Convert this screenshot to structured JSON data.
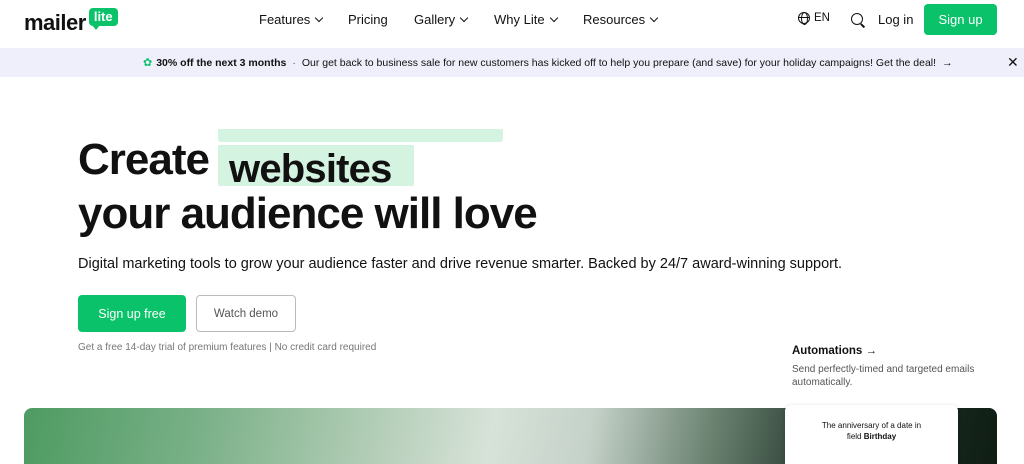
{
  "header": {
    "logo_text": "mailer",
    "logo_badge": "lite",
    "nav": [
      {
        "label": "Features",
        "has_dropdown": true
      },
      {
        "label": "Pricing",
        "has_dropdown": false
      },
      {
        "label": "Gallery",
        "has_dropdown": true
      },
      {
        "label": "Why Lite",
        "has_dropdown": true
      },
      {
        "label": "Resources",
        "has_dropdown": true
      }
    ],
    "language": "EN",
    "login_label": "Log in",
    "signup_label": "Sign up"
  },
  "promo": {
    "icon": "clover-icon",
    "highlight": "30% off the next 3 months",
    "separator": "·",
    "message": "Our get back to business sale for new customers has kicked off to help you prepare (and save) for your holiday campaigns! Get the deal!",
    "arrow": "→",
    "close": "✕"
  },
  "hero": {
    "headline_start": "Create",
    "headline_rotating_word": "websites",
    "headline_end": "your audience will love",
    "subheadline": "Digital marketing tools to grow your audience faster and drive revenue smarter. Backed by 24/7 award-winning support.",
    "primary_cta": "Sign up free",
    "secondary_cta": "Watch demo",
    "trial_note": "Get a free 14-day trial of premium features | No credit card required"
  },
  "feature_callout": {
    "title": "Automations",
    "arrow": "→",
    "description": "Send perfectly-timed and targeted emails automatically."
  },
  "preview_card": {
    "line1": "The anniversary of a date in",
    "line2_prefix": "field ",
    "line2_bold": "Birthday"
  },
  "colors": {
    "brand_green": "#09c269",
    "highlight_green": "#d4f3e1",
    "promo_bg": "#efeefb"
  }
}
